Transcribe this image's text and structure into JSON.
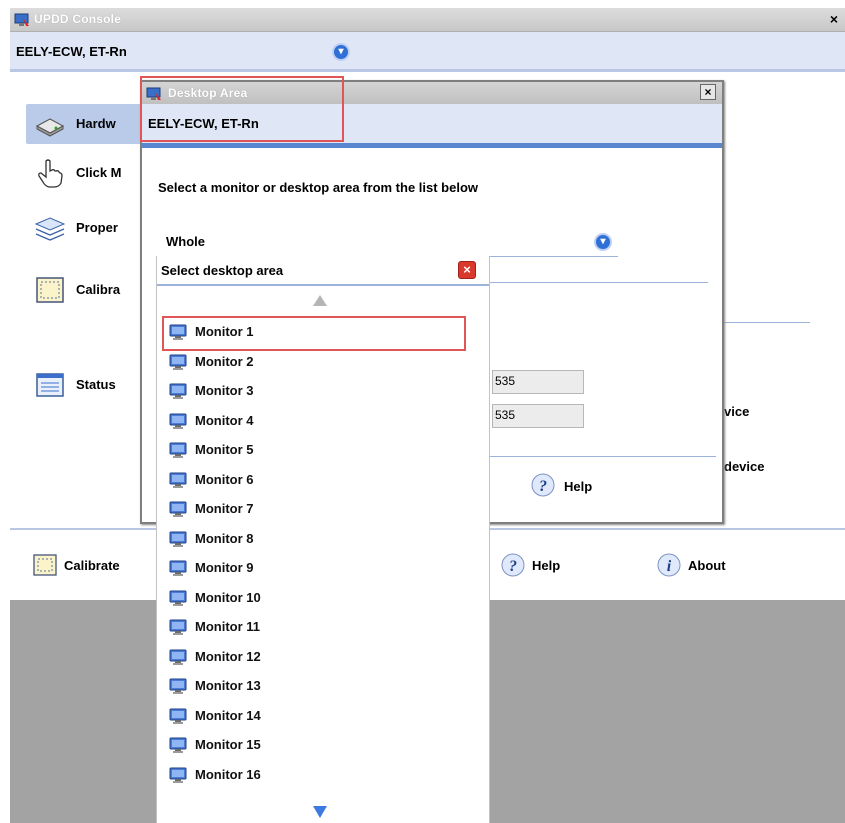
{
  "main_window": {
    "title": "UPDD Console",
    "close_label": "×",
    "device_name": "EELY-ECW, ET-Rn",
    "nav": {
      "hardware": "Hardw",
      "click_mode": "Click M",
      "properties": "Proper",
      "calibrate": "Calibra",
      "status": "Status"
    },
    "right_texts": {
      "device_1": "vice",
      "device_2": "device"
    },
    "bottom": {
      "calibrate": "Calibrate",
      "help": "Help",
      "about": "About"
    }
  },
  "dialog": {
    "title": "Desktop Area",
    "close_label": "×",
    "device_name": "EELY-ECW, ET-Rn",
    "select_label": "Select a monitor or desktop area from the list below",
    "selected_area": "Whole",
    "field_1": "535",
    "field_2": "535",
    "help_label": "Help"
  },
  "dropdown": {
    "header": "Select desktop area",
    "close_label": "×",
    "items": [
      "Monitor 1",
      "Monitor 2",
      "Monitor 3",
      "Monitor 4",
      "Monitor 5",
      "Monitor 6",
      "Monitor 7",
      "Monitor 8",
      "Monitor 9",
      "Monitor 10",
      "Monitor 11",
      "Monitor 12",
      "Monitor 13",
      "Monitor 14",
      "Monitor 15",
      "Monitor 16"
    ],
    "highlighted_item": "Monitor 1"
  },
  "colors": {
    "accent_blue": "#2f6fd6",
    "highlight_red": "#e05555",
    "bar_blue": "#dfe7f6"
  }
}
